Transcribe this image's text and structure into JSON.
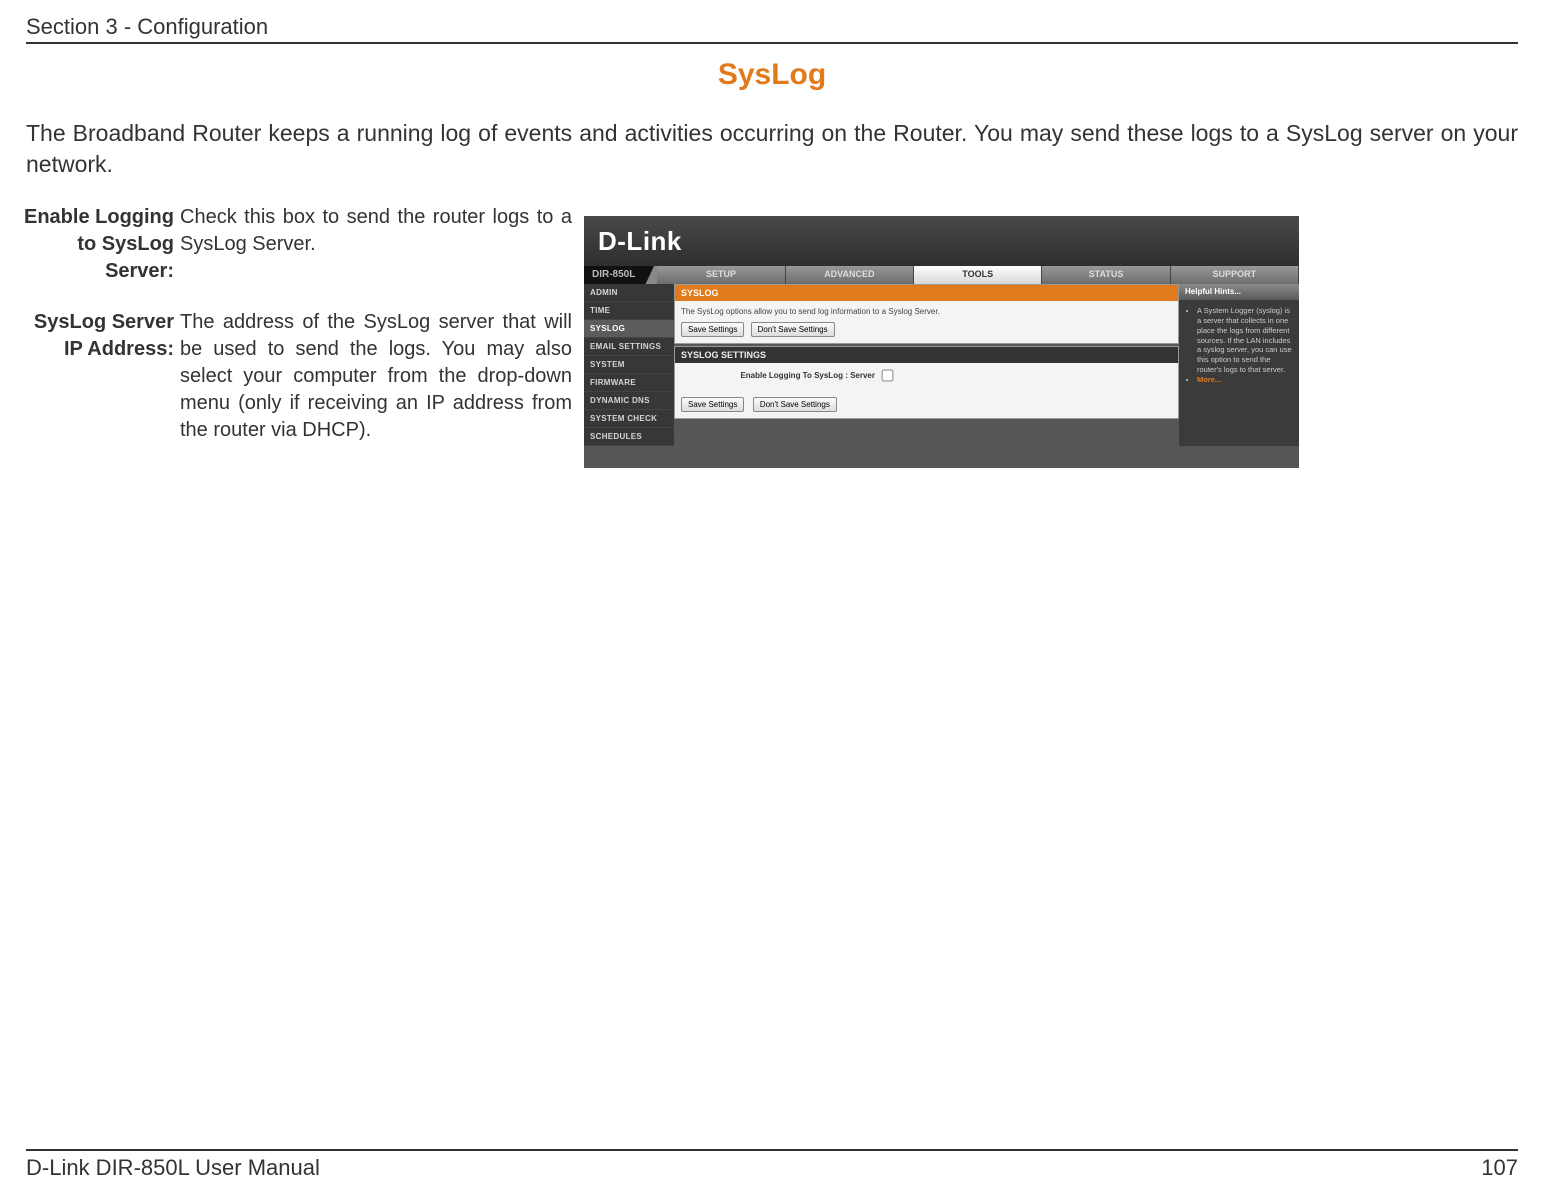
{
  "header": {
    "section": "Section 3 - Configuration"
  },
  "title": "SysLog",
  "intro": "The Broadband Router keeps a running log of events and activities occurring on the Router. You may send these logs to a SysLog server on your network.",
  "defs": {
    "enable_label": "Enable Logging to SysLog Server:",
    "enable_text": "Check this box to send the router logs to a SysLog Server.",
    "ip_label": "SysLog Server IP Address:",
    "ip_text": "The address of the SysLog server that will be used to send the logs. You may also select your computer from the drop-down menu (only if receiving an IP address from the router via DHCP)."
  },
  "router": {
    "brand": "D-Link",
    "model": "DIR-850L",
    "tabs": {
      "setup": "SETUP",
      "advanced": "ADVANCED",
      "tools": "TOOLS",
      "status": "STATUS",
      "support": "SUPPORT"
    },
    "sidenav": {
      "admin": "ADMIN",
      "time": "TIME",
      "syslog": "SYSLOG",
      "email": "EMAIL SETTINGS",
      "system": "SYSTEM",
      "firmware": "FIRMWARE",
      "ddns": "DYNAMIC DNS",
      "syscheck": "SYSTEM CHECK",
      "schedules": "SCHEDULES"
    },
    "panel1": {
      "heading": "SYSLOG",
      "text": "The SysLog options allow you to send log information to a Syslog Server.",
      "save": "Save Settings",
      "dont": "Don't Save Settings"
    },
    "panel2": {
      "heading": "SYSLOG SETTINGS",
      "label": "Enable Logging To SysLog : Server",
      "save": "Save Settings",
      "dont": "Don't Save Settings"
    },
    "hints": {
      "heading": "Helpful Hints...",
      "text": "A System Logger (syslog) is a server that collects in one place the logs from different sources. If the LAN includes a syslog server, you can use this option to send the router's logs to that server.",
      "more": "More..."
    }
  },
  "footer": {
    "manual": "D-Link DIR-850L User Manual",
    "page": "107"
  }
}
